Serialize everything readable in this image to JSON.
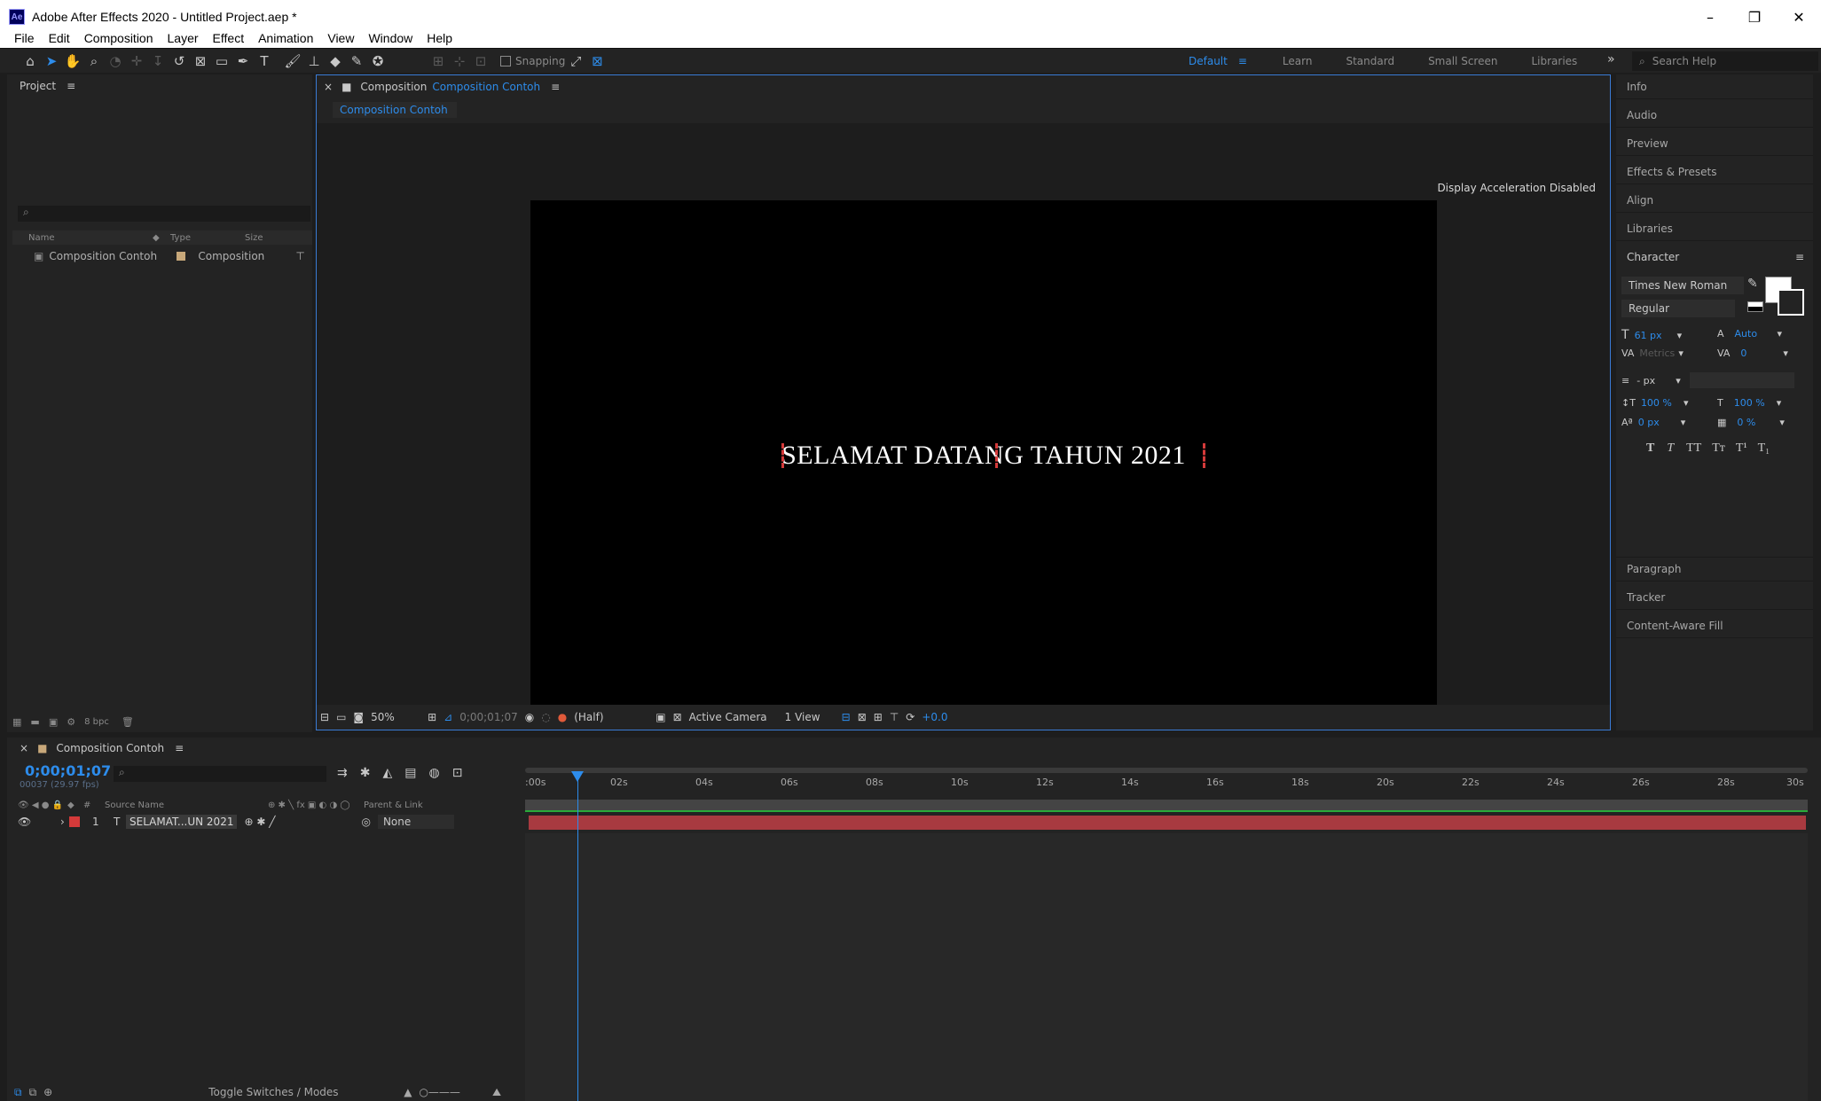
{
  "window": {
    "title": "Adobe After Effects 2020 - Untitled Project.aep *",
    "app_badge": "Ae",
    "controls": [
      "–",
      "❐",
      "✕"
    ]
  },
  "menu": [
    "File",
    "Edit",
    "Composition",
    "Layer",
    "Effect",
    "Animation",
    "View",
    "Window",
    "Help"
  ],
  "toolbar": {
    "snapping_label": "Snapping",
    "workspaces": [
      "Default",
      "Learn",
      "Standard",
      "Small Screen",
      "Libraries"
    ],
    "active_workspace": "Default",
    "more": "»",
    "search_placeholder": "Search Help"
  },
  "project": {
    "title": "Project",
    "columns": [
      "Name",
      "Type",
      "Size"
    ],
    "items": [
      {
        "name": "Composition Contoh",
        "type": "Composition"
      }
    ],
    "bpc": "8 bpc"
  },
  "composition": {
    "tab_prefix": "Composition",
    "tab_name": "Composition Contoh",
    "subtab": "Composition Contoh",
    "notice": "Display Acceleration Disabled",
    "text_layer": "SELAMAT DATANG TAHUN 2021",
    "zoom": "50%",
    "timecode": "0;00;01;07",
    "resolution": "(Half)",
    "camera": "Active Camera",
    "views": "1 View",
    "exposure": "+0.0"
  },
  "right_panel": {
    "items_top": [
      "Info",
      "Audio",
      "Preview",
      "Effects & Presets",
      "Align",
      "Libraries"
    ],
    "character": {
      "title": "Character",
      "font": "Times New Roman",
      "style": "Regular",
      "size": "61 px",
      "leading": "Auto",
      "kerning": "Metrics",
      "tracking": "0",
      "stroke": "- px",
      "vscale": "100 %",
      "hscale": "100 %",
      "baseline": "0 px",
      "tsume": "0 %",
      "styles": [
        "T",
        "T",
        "TT",
        "Tт",
        "T¹",
        "T₁"
      ]
    },
    "items_bottom": [
      "Paragraph",
      "Tracker",
      "Content-Aware Fill"
    ]
  },
  "timeline": {
    "comp_name": "Composition Contoh",
    "timecode": "0;00;01;07",
    "frames": "00037 (29.97 fps)",
    "columns": [
      "Source Name",
      "Parent & Link"
    ],
    "layer": {
      "index": "1",
      "type": "T",
      "name": "SELAMAT...UN 2021",
      "parent": "None"
    },
    "ruler": [
      ":00s",
      "02s",
      "04s",
      "06s",
      "08s",
      "10s",
      "12s",
      "14s",
      "16s",
      "18s",
      "20s",
      "22s",
      "24s",
      "26s",
      "28s",
      "30s"
    ],
    "toggle_label": "Toggle Switches / Modes",
    "current_seconds": 1.23,
    "duration_seconds": 30
  },
  "colors": {
    "accent": "#2d8ceb",
    "layer_bar": "#a83a40",
    "label_red": "#d43a3a",
    "work_area": "#2aaa3a"
  }
}
